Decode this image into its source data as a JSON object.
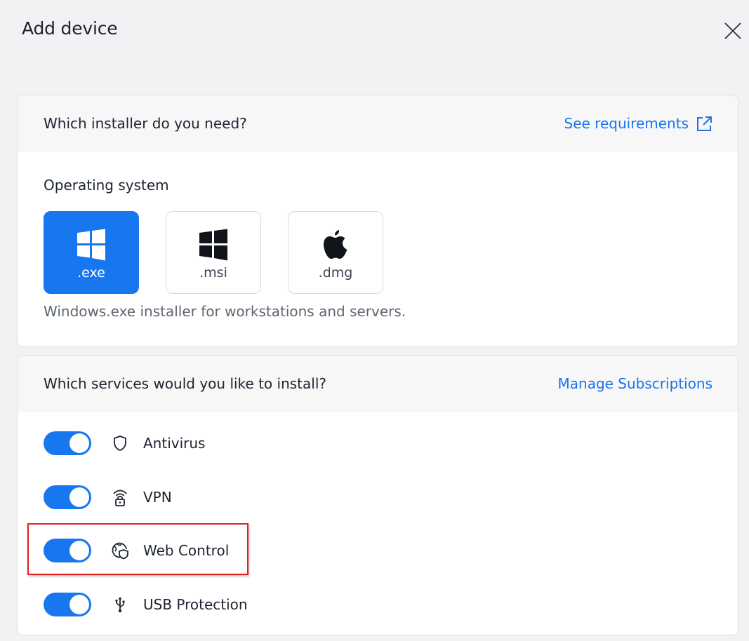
{
  "dialog": {
    "title": "Add device"
  },
  "installer": {
    "question": "Which installer do you need?",
    "link_label": "See requirements",
    "os_label": "Operating system",
    "options": [
      {
        "ext": ".exe",
        "icon": "windows-icon",
        "selected": true
      },
      {
        "ext": ".msi",
        "icon": "windows-icon",
        "selected": false
      },
      {
        "ext": ".dmg",
        "icon": "apple-icon",
        "selected": false
      }
    ],
    "description": "Windows.exe installer for workstations and servers."
  },
  "services": {
    "question": "Which services would you like to install?",
    "link_label": "Manage Subscriptions",
    "items": [
      {
        "label": "Antivirus",
        "icon": "shield-icon",
        "enabled": true
      },
      {
        "label": "VPN",
        "icon": "vpn-lock-icon",
        "enabled": true
      },
      {
        "label": "Web Control",
        "icon": "globe-shield-icon",
        "enabled": true
      },
      {
        "label": "USB Protection",
        "icon": "usb-icon",
        "enabled": true
      }
    ]
  },
  "colors": {
    "accent": "#1677ee",
    "link": "#1a73e8",
    "highlight": "#e0201f"
  }
}
